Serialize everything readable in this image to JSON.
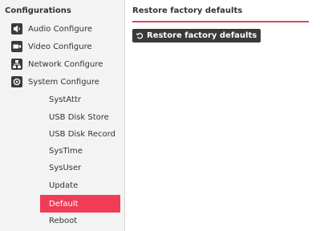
{
  "sidebar": {
    "header": "Configurations",
    "top_items": [
      {
        "label": "Audio Configure",
        "icon": "speaker-icon"
      },
      {
        "label": "Video Configure",
        "icon": "video-camera-icon"
      },
      {
        "label": "Network Configure",
        "icon": "network-icon"
      },
      {
        "label": "System Configure",
        "icon": "system-settings-icon"
      }
    ],
    "sub_items": [
      {
        "label": "SystAttr"
      },
      {
        "label": "USB Disk Store"
      },
      {
        "label": "USB Disk Record"
      },
      {
        "label": "SysTime"
      },
      {
        "label": "SysUser"
      },
      {
        "label": "Update"
      },
      {
        "label": "Default",
        "active": true
      },
      {
        "label": "Reboot"
      }
    ]
  },
  "main": {
    "title": "Restore factory defaults",
    "restore_button": {
      "label": "Restore factory defaults",
      "icon": "restore-icon"
    }
  },
  "colors": {
    "accent": "#f03c57",
    "rule": "#e0455d",
    "button_bg": "#3a3a3a",
    "sidebar_bg": "#f3f3f3"
  }
}
